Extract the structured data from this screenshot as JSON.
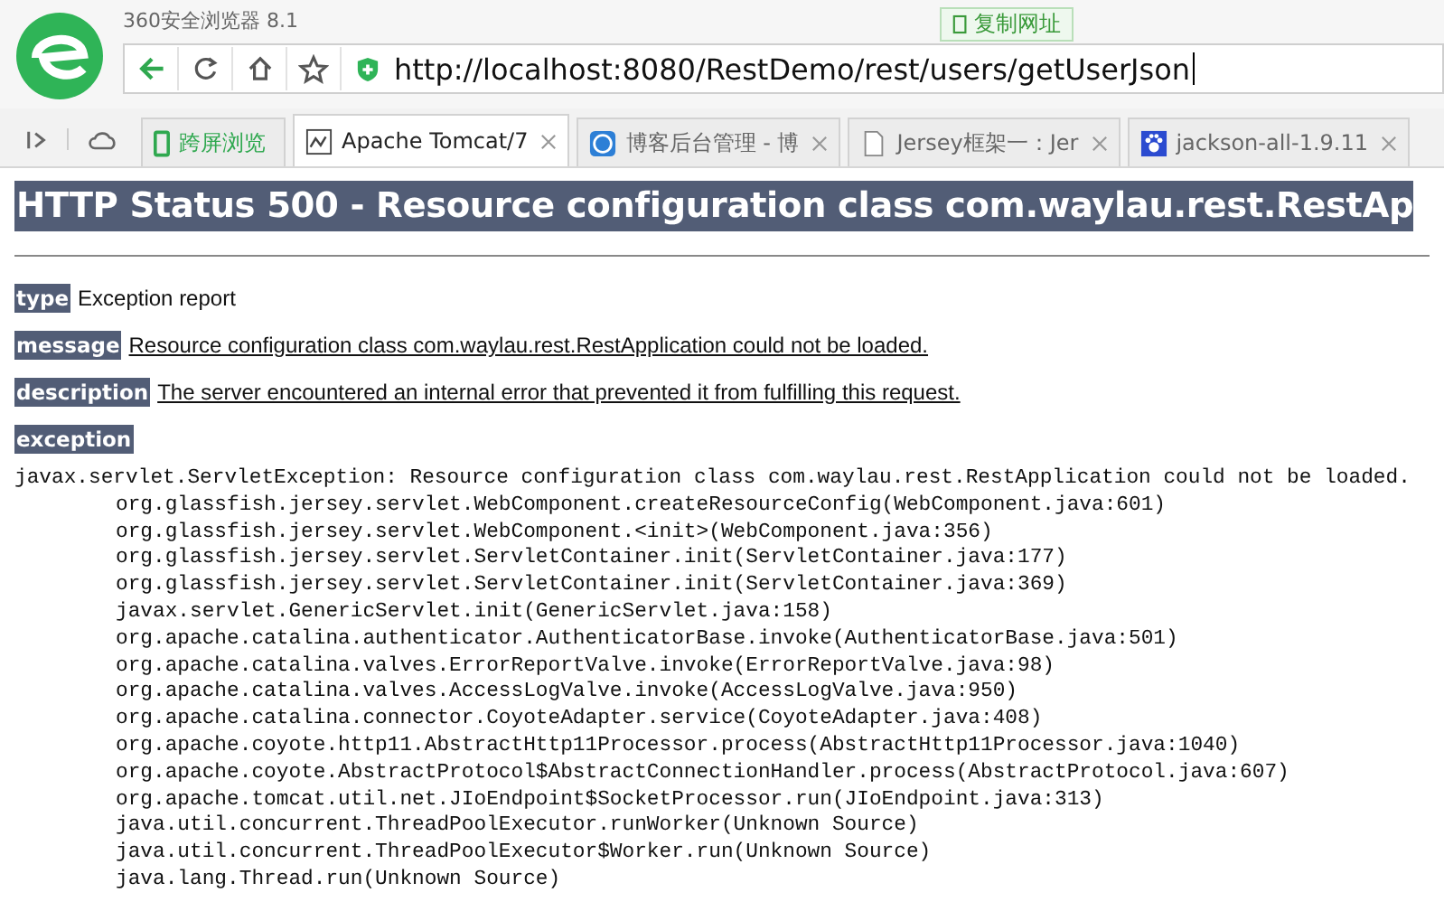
{
  "browser": {
    "title": "360安全浏览器 8.1",
    "copy_url_button": "复制网址",
    "address": {
      "value": "http://localhost:8080/RestDemo/rest/users/getUserJson"
    },
    "tabs": [
      {
        "label": "跨屏浏览",
        "kind": "quick",
        "selected": false
      },
      {
        "label": "Apache Tomcat/7",
        "kind": "page",
        "selected": true
      },
      {
        "label": "博客后台管理 - 博",
        "kind": "page",
        "selected": false
      },
      {
        "label": "Jersey框架一：Jer",
        "kind": "page",
        "selected": false
      },
      {
        "label": "jackson-all-1.9.11",
        "kind": "page",
        "selected": false
      }
    ]
  },
  "page": {
    "heading": "HTTP Status 500 - Resource configuration class com.waylau.rest.RestAp",
    "fields": [
      {
        "label": "type",
        "value": "Exception report",
        "underlined": false
      },
      {
        "label": "message",
        "value": "Resource configuration class com.waylau.rest.RestApplication could not be loaded.",
        "underlined": true
      },
      {
        "label": "description",
        "value": "The server encountered an internal error that prevented it from fulfilling this request.",
        "underlined": true
      }
    ],
    "exception_label": "exception",
    "stack": {
      "first_line": "javax.servlet.ServletException: Resource configuration class com.waylau.rest.RestApplication could not be loaded.",
      "frames": [
        "org.glassfish.jersey.servlet.WebComponent.createResourceConfig(WebComponent.java:601)",
        "org.glassfish.jersey.servlet.WebComponent.<init>(WebComponent.java:356)",
        "org.glassfish.jersey.servlet.ServletContainer.init(ServletContainer.java:177)",
        "org.glassfish.jersey.servlet.ServletContainer.init(ServletContainer.java:369)",
        "javax.servlet.GenericServlet.init(GenericServlet.java:158)",
        "org.apache.catalina.authenticator.AuthenticatorBase.invoke(AuthenticatorBase.java:501)",
        "org.apache.catalina.valves.ErrorReportValve.invoke(ErrorReportValve.java:98)",
        "org.apache.catalina.valves.AccessLogValve.invoke(AccessLogValve.java:950)",
        "org.apache.catalina.connector.CoyoteAdapter.service(CoyoteAdapter.java:408)",
        "org.apache.coyote.http11.AbstractHttp11Processor.process(AbstractHttp11Processor.java:1040)",
        "org.apache.coyote.AbstractProtocol$AbstractConnectionHandler.process(AbstractProtocol.java:607)",
        "org.apache.tomcat.util.net.JIoEndpoint$SocketProcessor.run(JIoEndpoint.java:313)",
        "java.util.concurrent.ThreadPoolExecutor.runWorker(Unknown Source)",
        "java.util.concurrent.ThreadPoolExecutor$Worker.run(Unknown Source)",
        "java.lang.Thread.run(Unknown Source)"
      ]
    }
  }
}
